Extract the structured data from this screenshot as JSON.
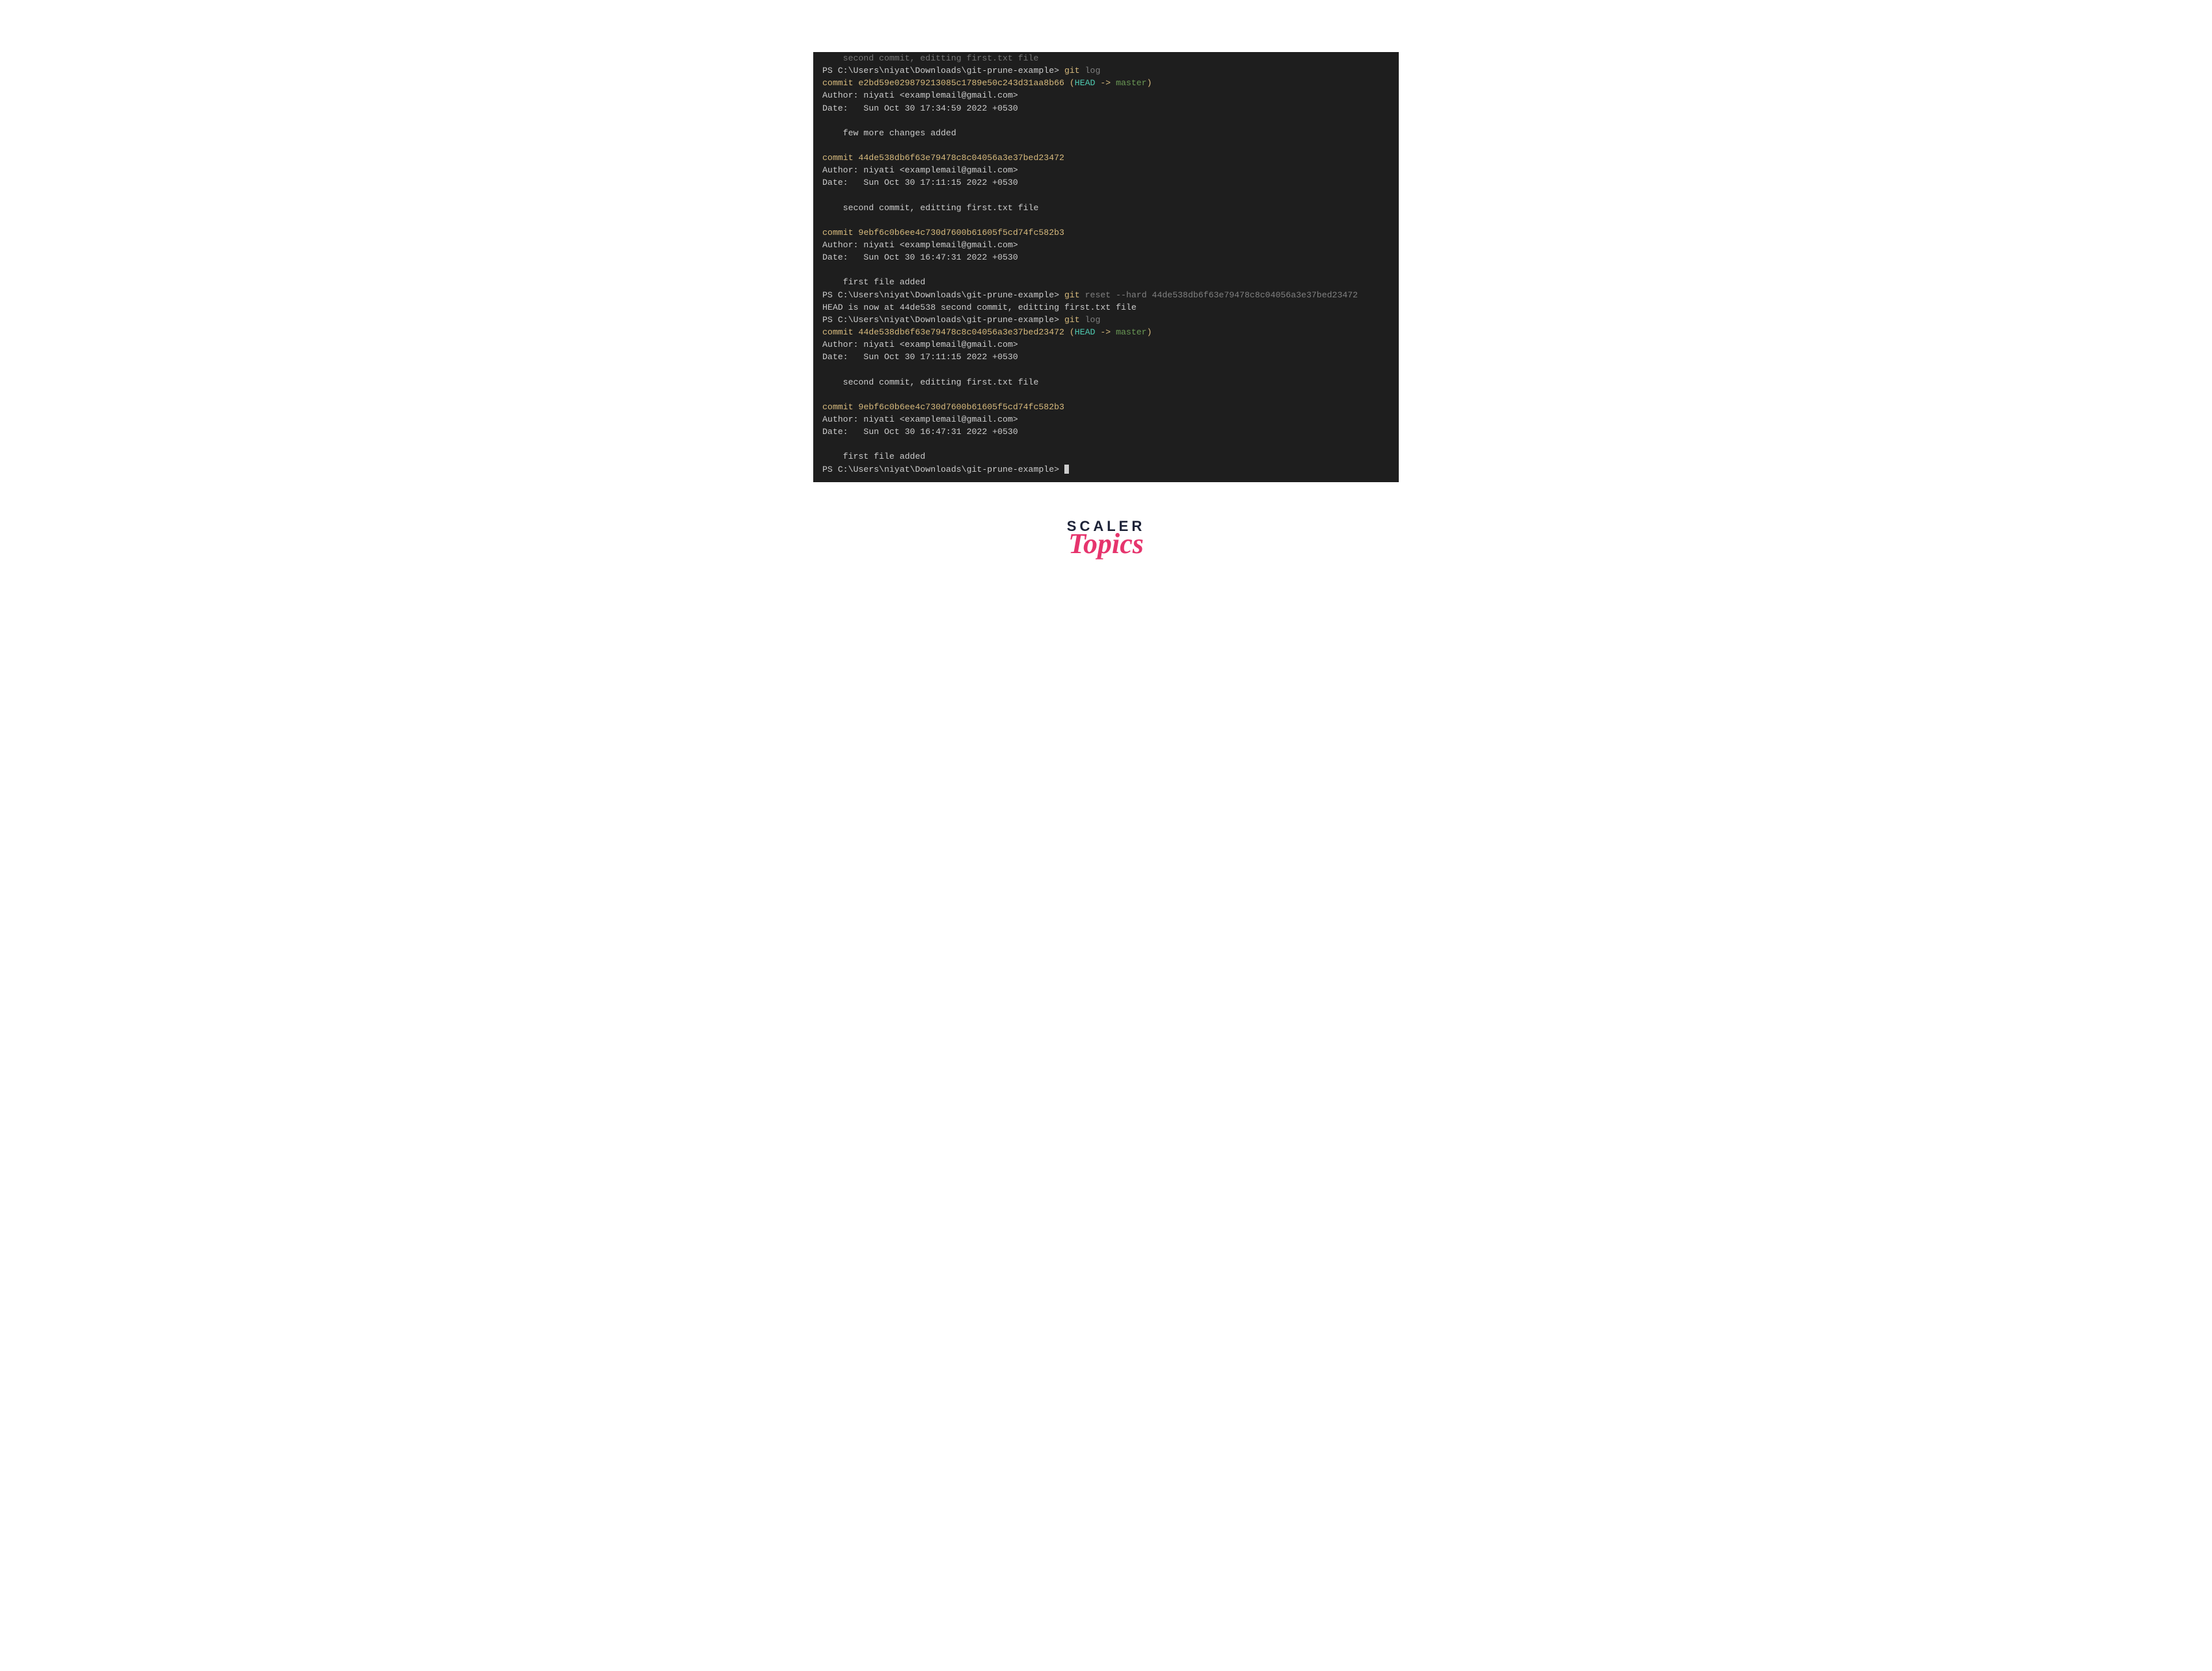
{
  "terminal": {
    "clipped_top": "    second commit, editting first.txt file",
    "prompt_path": "PS C:\\Users\\niyat\\Downloads\\git-prune-example>",
    "cmd_git": "git",
    "cmd_log": "log",
    "cmd_reset": "reset",
    "reset_flag": "--hard",
    "reset_hash": "44de538db6f63e79478c8c04056a3e37bed23472",
    "reset_output": "HEAD is now at 44de538 second commit, editting first.txt file",
    "head_label": "HEAD",
    "arrow": " -> ",
    "branch": "master",
    "commits_first": [
      {
        "hash": "e2bd59e029879213085c1789e50c243d31aa8b66",
        "is_head": true,
        "author": "Author: niyati <examplemail@gmail.com>",
        "date": "Date:   Sun Oct 30 17:34:59 2022 +0530",
        "message": "    few more changes added"
      },
      {
        "hash": "44de538db6f63e79478c8c04056a3e37bed23472",
        "is_head": false,
        "author": "Author: niyati <examplemail@gmail.com>",
        "date": "Date:   Sun Oct 30 17:11:15 2022 +0530",
        "message": "    second commit, editting first.txt file"
      },
      {
        "hash": "9ebf6c0b6ee4c730d7600b61605f5cd74fc582b3",
        "is_head": false,
        "author": "Author: niyati <examplemail@gmail.com>",
        "date": "Date:   Sun Oct 30 16:47:31 2022 +0530",
        "message": "    first file added"
      }
    ],
    "commits_second": [
      {
        "hash": "44de538db6f63e79478c8c04056a3e37bed23472",
        "is_head": true,
        "author": "Author: niyati <examplemail@gmail.com>",
        "date": "Date:   Sun Oct 30 17:11:15 2022 +0530",
        "message": "    second commit, editting first.txt file"
      },
      {
        "hash": "9ebf6c0b6ee4c730d7600b61605f5cd74fc582b3",
        "is_head": false,
        "author": "Author: niyati <examplemail@gmail.com>",
        "date": "Date:   Sun Oct 30 16:47:31 2022 +0530",
        "message": "    first file added"
      }
    ]
  },
  "logo": {
    "line1": "SCALER",
    "line2": "Topics"
  }
}
